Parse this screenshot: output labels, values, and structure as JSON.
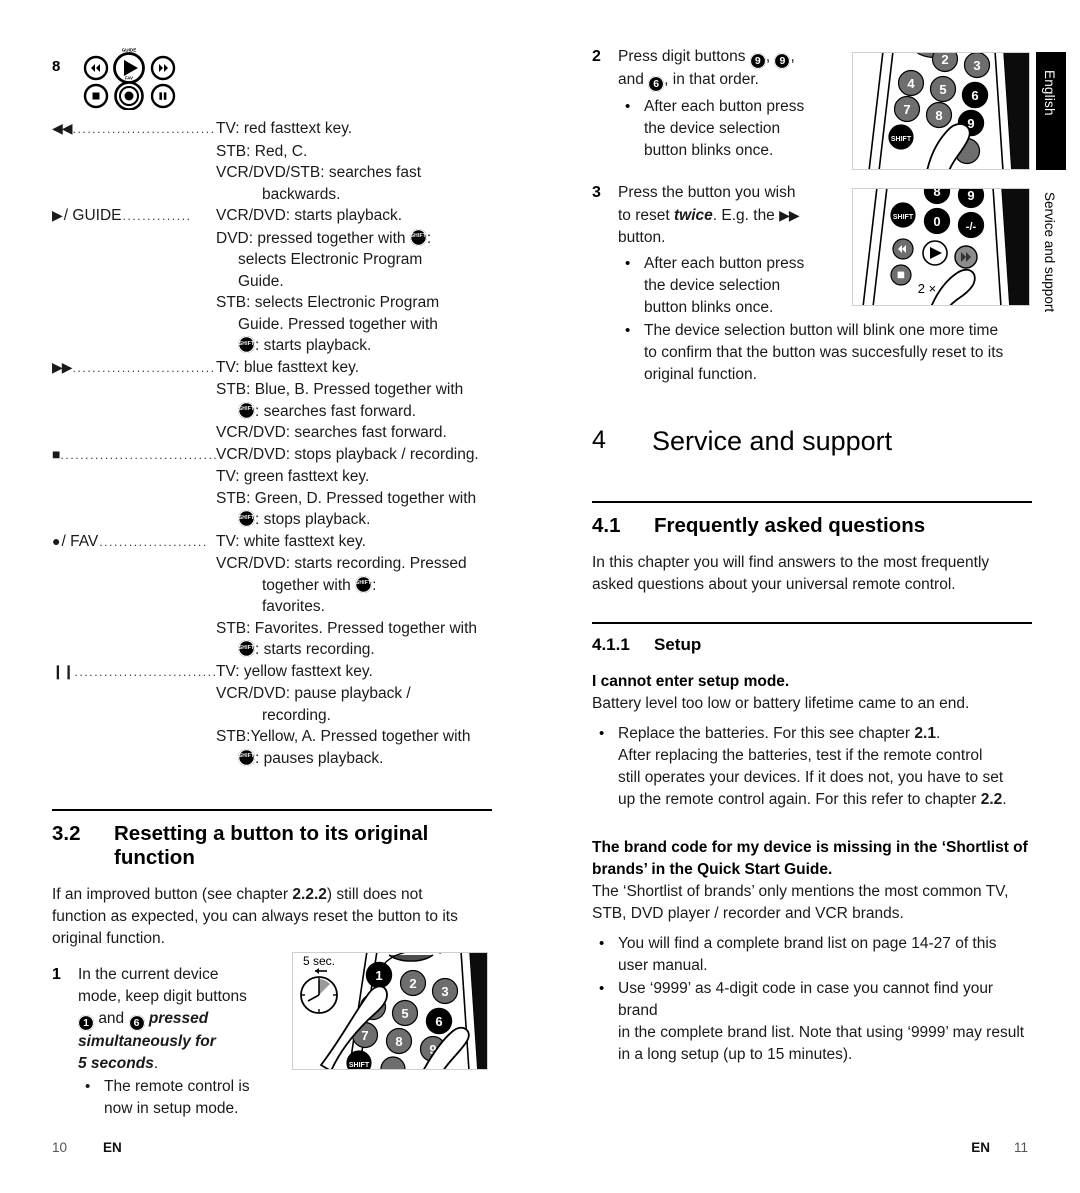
{
  "side_tab": {
    "language": "English",
    "chapter": "Service and support"
  },
  "left_page": {
    "footer": {
      "page": "10",
      "lang": "EN"
    },
    "key_cluster": {
      "item_number": "8",
      "buttons": [
        "rewind",
        "play",
        "fast-forward",
        "stop",
        "record",
        "pause"
      ],
      "top_label": "GUIDE",
      "bottom_label": "FAV"
    },
    "key_entries": [
      {
        "glyph": "◀◀",
        "label": "",
        "leader": "...........................................",
        "lines": [
          {
            "indent": 0,
            "text": "TV: red fasttext key."
          },
          {
            "indent": 0,
            "text": "STB: Red, C."
          },
          {
            "indent": 0,
            "text": "VCR/DVD/STB: searches fast"
          },
          {
            "indent": 2,
            "text": "backwards."
          }
        ]
      },
      {
        "glyph": "▶",
        "label": "/ GUIDE",
        "leader": "..............",
        "lines": [
          {
            "indent": 0,
            "text": "VCR/DVD: starts playback."
          },
          {
            "indent": 0,
            "text": "DVD: pressed together with ",
            "shift_after": true,
            "text_after": ":"
          },
          {
            "indent": 1,
            "text": "selects Electronic Program"
          },
          {
            "indent": 1,
            "text": "Guide."
          },
          {
            "indent": 0,
            "text": "STB: selects Electronic Program"
          },
          {
            "indent": 1,
            "text": "Guide. Pressed together with"
          },
          {
            "indent": 1,
            "shift_first": true,
            "text_after": ": starts playback."
          }
        ]
      },
      {
        "glyph": "▶▶",
        "label": "",
        "leader": "...................................",
        "lines": [
          {
            "indent": 0,
            "text": "TV: blue fasttext key."
          },
          {
            "indent": 0,
            "text": "STB: Blue, B. Pressed together with"
          },
          {
            "indent": 1,
            "shift_first": true,
            "text_after": ": searches fast forward."
          },
          {
            "indent": 0,
            "text": "VCR/DVD: searches fast forward."
          }
        ]
      },
      {
        "glyph": "■",
        "label": "",
        "leader": "......................................",
        "lines": [
          {
            "indent": 0,
            "text": "VCR/DVD: stops playback / recording."
          },
          {
            "indent": 0,
            "text": "TV: green fasttext key."
          },
          {
            "indent": 0,
            "text": "STB: Green, D. Pressed together with"
          },
          {
            "indent": 1,
            "shift_first": true,
            "text_after": ": stops playback."
          }
        ]
      },
      {
        "glyph": "●",
        "label": "/ FAV",
        "leader": "......................",
        "lines": [
          {
            "indent": 0,
            "text": "TV: white fasttext key."
          },
          {
            "indent": 0,
            "text": "VCR/DVD: starts recording. Pressed"
          },
          {
            "indent": 2,
            "text": "together with ",
            "shift_after": true,
            "text_after": ":"
          },
          {
            "indent": 2,
            "text": "favorites."
          },
          {
            "indent": 0,
            "text": "STB: Favorites. Pressed together with"
          },
          {
            "indent": 1,
            "shift_first": true,
            "text_after": ": starts recording."
          }
        ]
      },
      {
        "glyph": "❙❙",
        "label": "",
        "leader": "...................................",
        "lines": [
          {
            "indent": 0,
            "text": "TV: yellow fasttext key."
          },
          {
            "indent": 0,
            "text": "VCR/DVD: pause playback /"
          },
          {
            "indent": 2,
            "text": "recording."
          },
          {
            "indent": 0,
            "text": "STB:Yellow, A. Pressed together with"
          },
          {
            "indent": 1,
            "shift_first": true,
            "text_after": ": pauses playback."
          }
        ]
      }
    ],
    "section_3_2": {
      "number": "3.2",
      "title": "Resetting a button to its original function",
      "intro_line_1": "If an improved button (see chapter ",
      "intro_chapter_ref": "2.2.2",
      "intro_line_1_end": ") still does not",
      "intro_line_2": "function as expected, you can always reset the button to its",
      "intro_line_3": "original function.",
      "step_1": {
        "number": "1",
        "line_1": "In the current device",
        "line_2": "mode, keep digit buttons",
        "digit_a": "1",
        "and": "and",
        "digit_b": "6",
        "emph_1": "pressed",
        "emph_2": "simultaneously for",
        "emph_3": "5 seconds",
        "period": ".",
        "bullet_1": "The remote control is",
        "bullet_2": "now in setup mode."
      },
      "figure_1": {
        "name": "remote-keypad-two-fingers",
        "timer_label": "5 sec.",
        "highlight_keys": [
          "1",
          "6"
        ]
      }
    }
  },
  "right_page": {
    "footer": {
      "page": "11",
      "lang": "EN"
    },
    "step_2": {
      "number": "2",
      "line_1_pre": "Press digit buttons ",
      "digit_1": "9",
      "digit_2": "9",
      "line_2_pre": "and ",
      "digit_3": "6",
      "line_2_post": ", in that order.",
      "bullets": [
        [
          "After each button press",
          "the device selection",
          "button blinks once."
        ]
      ]
    },
    "step_3": {
      "number": "3",
      "line_1": "Press the button you wish",
      "line_2_pre": "to reset ",
      "line_2_emph": "twice",
      "line_2_post": ". E.g. the ",
      "line_2_glyph": "▶▶",
      "line_3": "button.",
      "bullets": [
        [
          "After each button press",
          "the device selection",
          "button blinks once."
        ],
        [
          "The device selection button will blink one more time",
          "to confirm that the button was succesfully reset to its",
          "original function."
        ]
      ]
    },
    "figure_2": {
      "name": "remote-keypad-press-digit",
      "highlight_keys": [
        "6",
        "9"
      ]
    },
    "figure_3": {
      "name": "remote-press-fastforward-twice",
      "annotation": "2 ×"
    },
    "chapter_4": {
      "number": "4",
      "title": "Service and support"
    },
    "section_4_1": {
      "number": "4.1",
      "title": "Frequently asked questions",
      "paragraph_1": "In this chapter you will find answers to the most frequently",
      "paragraph_2": "asked questions about your universal remote control."
    },
    "section_4_1_1": {
      "number": "4.1.1",
      "title": "Setup",
      "faq_1": {
        "question": "I cannot enter setup mode.",
        "answer": "Battery level too low or battery lifetime came to an end.",
        "bullet": [
          {
            "pre": "Replace the batteries. For this see chapter ",
            "ref": "2.1",
            "post": "."
          },
          {
            "pre": "After replacing the batteries, test if the remote control"
          },
          {
            "pre": "still operates your devices. If it does not, you have to set"
          },
          {
            "pre": "up the remote control again. For this refer to chapter ",
            "ref": "2.2",
            "post": "."
          }
        ]
      },
      "faq_2": {
        "question_line_1": "The brand code for my device is missing in the ‘Shortlist of",
        "question_line_2": "brands’ in the Quick Start Guide.",
        "answer_line_1": "The ‘Shortlist of brands’ only mentions the most common TV,",
        "answer_line_2": "STB, DVD player / recorder and VCR brands.",
        "bullets": [
          [
            "You will find a complete brand list on page 14-27 of this",
            "user manual."
          ],
          [
            "Use ‘9999’ as 4-digit code in case you cannot find your brand",
            "in the complete brand list. Note that using ‘9999’ may result",
            "in a long setup (up to 15 minutes)."
          ]
        ]
      }
    }
  }
}
